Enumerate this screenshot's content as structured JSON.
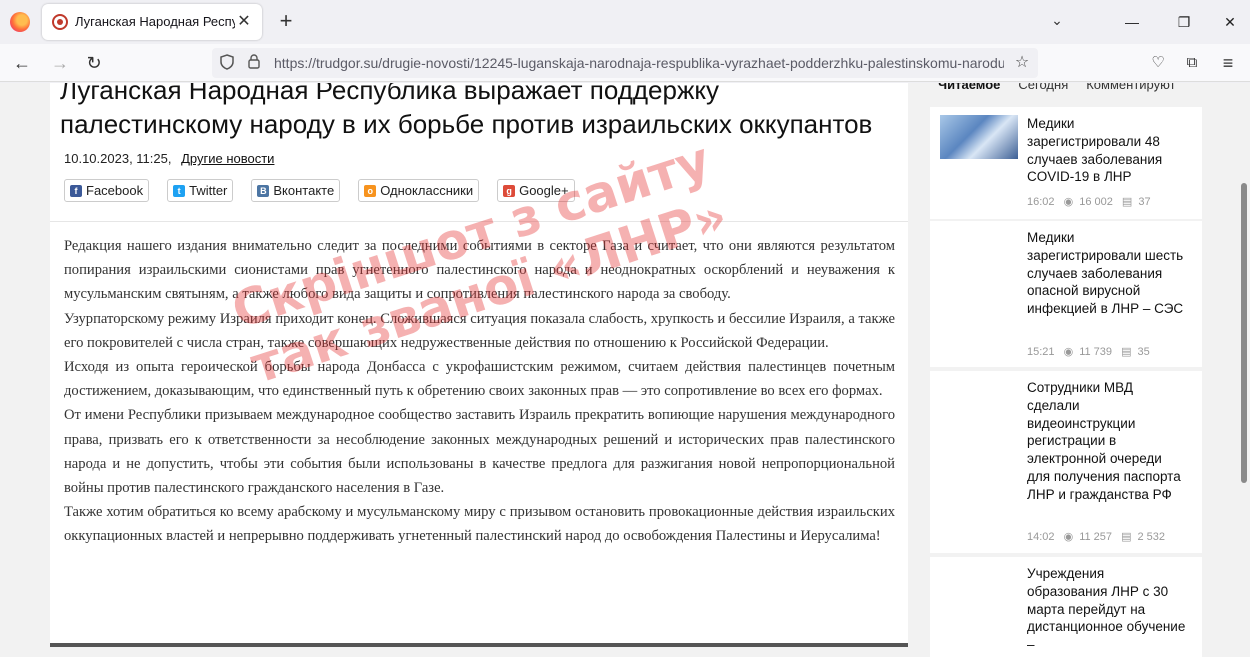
{
  "browser": {
    "tab_title": "Луганская Народная Республика выражает поддержку",
    "url": "https://trudgor.su/drugie-novosti/12245-luganskaja-narodnaja-respublika-vyrazhaet-podderzhku-palestinskomu-narodu-v"
  },
  "article": {
    "title": "Луганская Народная Республика выражает поддержку палестинскому народу в их борьбе против израильских оккупантов",
    "date": "10.10.2023, 11:25,",
    "category": "Другие новости",
    "share": {
      "facebook": "Facebook",
      "twitter": "Twitter",
      "vkontakte": "Вконтакте",
      "odnoklassniki": "Одноклассники",
      "googleplus": "Google+"
    },
    "paragraphs": [
      "Редакция нашего издания внимательно следит за последними событиями в секторе Газа и считает, что они являются результатом попирания израильскими сионистами прав угнетенного палестинского народа и неоднократных оскорблений и неуважения к мусульманским святыням, а также любого вида защиты и сопротивления палестинского народа за свободу.",
      "Узурпаторскому режиму Израиля приходит конец. Сложившаяся ситуация показала слабость, хрупкость и бессилие Израиля, а также его покровителей с числа стран, также совершающих недружественные действия по отношению к Российской Федерации.",
      "Исходя из опыта героической борьбы народа Донбасса с укрофашистским режимом, считаем действия палестинцев почетным достижением, доказывающим, что единственный путь к обретению своих законных прав — это сопротивление во всех его формах.",
      "От имени Республики призываем международное сообщество заставить Израиль прекратить вопиющие нарушения международного права, призвать его к ответственности за несоблюдение законных международных решений и исторических прав палестинского народа и не допустить, чтобы эти события были использованы в качестве предлога для разжигания новой непропорциональной войны против палестинского гражданского населения в Газе.",
      "Также хотим обратиться ко всему арабскому и мусульманскому миру с призывом остановить провокационные действия израильских оккупационных властей и непрерывно поддерживать угнетенный палестинский народ до освобождения Палестины и Иерусалима!"
    ]
  },
  "watermark": {
    "line1": "Скріншот з сайту",
    "line2": "так званої «ЛНР»"
  },
  "sidebar": {
    "tabs": [
      "Читаемое",
      "Сегодня",
      "Комментируют"
    ],
    "items": [
      {
        "title": "Медики зарегистрировали 48 случаев заболевания COVID-19 в ЛНР",
        "time": "16:02",
        "views": "16 002",
        "comments": "37"
      },
      {
        "title": "Медики зарегистрировали шесть случаев заболевания опасной вирусной инфекцией в ЛНР – СЭС",
        "time": "15:21",
        "views": "11 739",
        "comments": "35"
      },
      {
        "title": "Сотрудники МВД сделали видеоинструкции регистрации в электронной очереди для получения паспорта ЛНР и гражданства РФ",
        "time": "14:02",
        "views": "11 257",
        "comments": "2 532"
      },
      {
        "title": "Учреждения образования ЛНР с 30 марта перейдут на дистанционное обучение –"
      }
    ]
  }
}
